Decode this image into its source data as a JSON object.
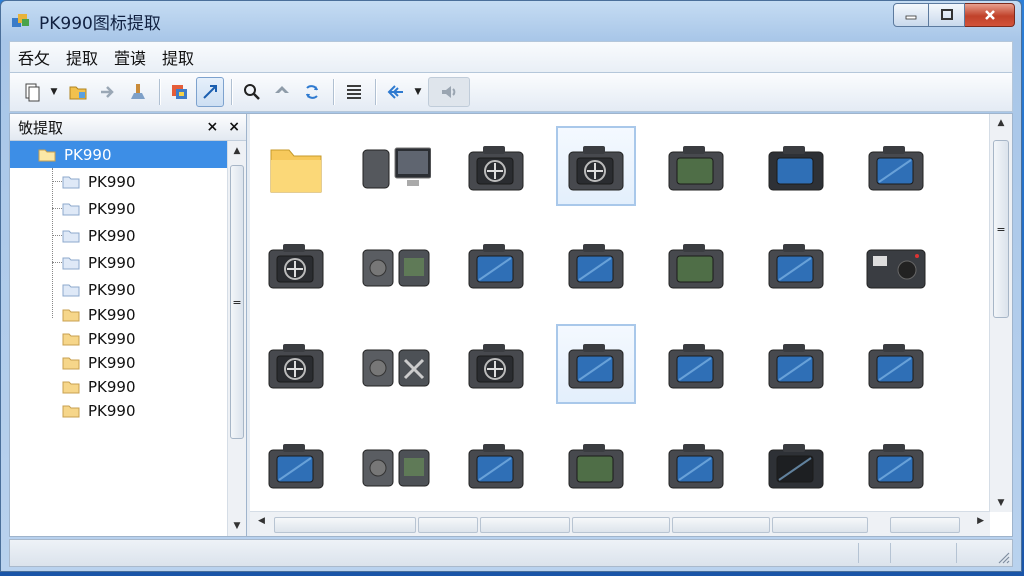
{
  "window": {
    "title": "PK990图标提取",
    "controls": {
      "minimize": "minimize",
      "maximize": "maximize",
      "close": "close"
    }
  },
  "menu": {
    "items": [
      "呑攵",
      "提取",
      "萓谟",
      "提取"
    ]
  },
  "toolbar": {
    "buttons": [
      "new-document-icon",
      "folder-icon",
      "forward-arrow-icon",
      "tools-icon",
      "extract-icon",
      "resize-arrow-icon",
      "search-icon",
      "back-icon",
      "refresh-icon",
      "list-view-icon",
      "back-arrow-icon",
      "sound-icon"
    ]
  },
  "left_pane": {
    "title": "敂提取",
    "close_glyph": "×",
    "pin_glyph": "⨯",
    "tree": [
      {
        "label": "PK990",
        "selected": true
      },
      {
        "label": "PK990"
      },
      {
        "label": "PK990"
      },
      {
        "label": "PK990"
      },
      {
        "label": "PK990"
      },
      {
        "label": "PK990"
      },
      {
        "label": "PK990"
      },
      {
        "label": "PK990"
      },
      {
        "label": "PK990"
      },
      {
        "label": "PK990"
      },
      {
        "label": "PK990"
      }
    ],
    "scroll_glyph": "="
  },
  "icon_grid": {
    "rows": [
      [
        "folder",
        "device-monitor",
        "camera-dial",
        "camera-dial-selected",
        "camera-green",
        "camera-dark",
        "monitor-blue"
      ],
      [
        "camera-plus",
        "camera-pair",
        "monitor-blue",
        "monitor-blue",
        "camera-green",
        "monitor-blue",
        "radio-device"
      ],
      [
        "camera-gear",
        "device-pair-x",
        "camera-dial",
        "monitor-blue-selected",
        "monitor-blue",
        "monitor-blue",
        "monitor-blue"
      ],
      [
        "monitor-blue",
        "camera-pair",
        "camera-blue",
        "camera-green",
        "camera-blue",
        "monitor-dark",
        "camera-blue"
      ]
    ],
    "scroll_glyph": "="
  },
  "colors": {
    "accent": "#3d8ee6",
    "titlebar": "#c5dcf3",
    "close_red": "#c0412a"
  }
}
